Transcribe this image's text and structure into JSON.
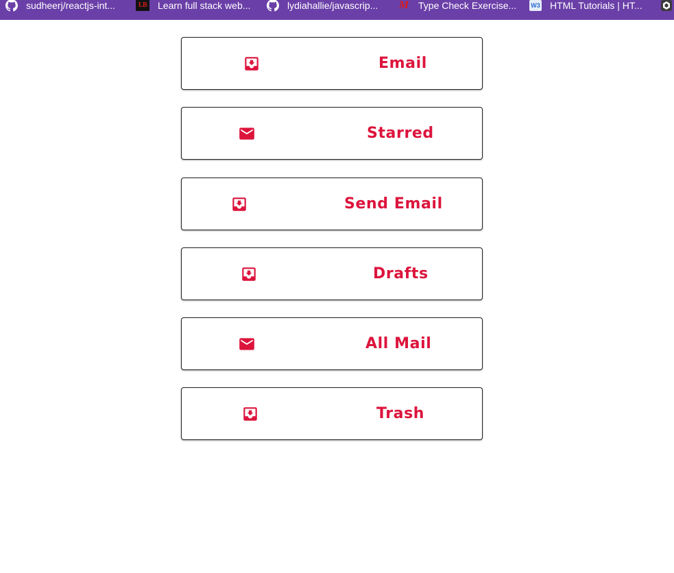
{
  "bookmarks_bar": {
    "items": [
      {
        "label": "sudheerj/reactjs-int...",
        "icon": "github-icon"
      },
      {
        "label": "Learn full stack web...",
        "icon": "lb-logo-icon",
        "icon_text": "LB"
      },
      {
        "label": "lydiahallie/javascrip...",
        "icon": "github-icon"
      },
      {
        "label": "Type Check Exercise...",
        "icon": "m-logo-icon",
        "icon_text": "M"
      },
      {
        "label": "HTML Tutorials | HT...",
        "icon": "w3-logo-icon",
        "icon_text": "W3"
      },
      {
        "label": "",
        "icon": "extension-icon"
      }
    ]
  },
  "menu": {
    "accent_color": "#dc143c",
    "items": [
      {
        "label": "Email",
        "icon": "inbox-icon"
      },
      {
        "label": "Starred",
        "icon": "mail-icon"
      },
      {
        "label": "Send Email",
        "icon": "inbox-icon"
      },
      {
        "label": "Drafts",
        "icon": "inbox-icon"
      },
      {
        "label": "All Mail",
        "icon": "mail-icon"
      },
      {
        "label": "Trash",
        "icon": "inbox-icon"
      }
    ]
  }
}
